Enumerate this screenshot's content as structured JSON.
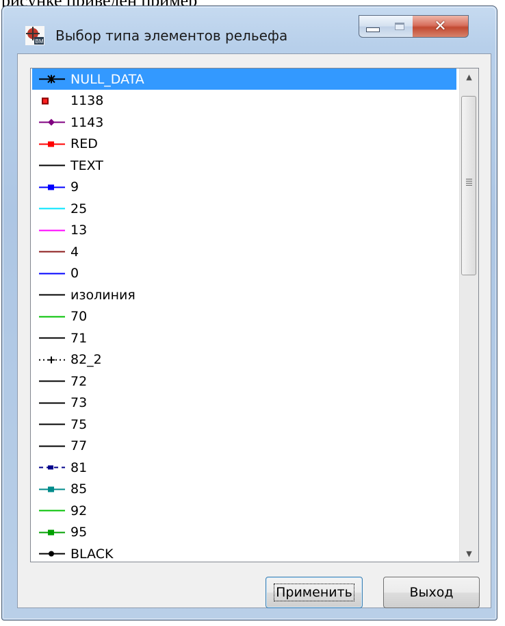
{
  "background_text": "рисунке приведен пример",
  "window": {
    "title": "Выбор типа элементов рельефа",
    "controls": {
      "minimize": "minimize-icon",
      "maximize": "maximize-icon",
      "close": "close-icon"
    }
  },
  "list": {
    "selected_index": 0,
    "items": [
      {
        "label": "NULL_DATA",
        "color": "#000000",
        "style": "star"
      },
      {
        "label": "1138",
        "color": "#8b0000",
        "style": "square-only"
      },
      {
        "label": "1143",
        "color": "#800080",
        "style": "diamond"
      },
      {
        "label": "RED",
        "color": "#ff0000",
        "style": "square"
      },
      {
        "label": "TEXT",
        "color": "#000000",
        "style": "line"
      },
      {
        "label": "9",
        "color": "#0000ff",
        "style": "square"
      },
      {
        "label": "25",
        "color": "#00e5ff",
        "style": "line"
      },
      {
        "label": "13",
        "color": "#ff00ff",
        "style": "line"
      },
      {
        "label": "4",
        "color": "#8b1a1a",
        "style": "line"
      },
      {
        "label": "0",
        "color": "#0000ff",
        "style": "line"
      },
      {
        "label": "изолиния",
        "color": "#000000",
        "style": "line"
      },
      {
        "label": "70",
        "color": "#00c000",
        "style": "line"
      },
      {
        "label": "71",
        "color": "#000000",
        "style": "line"
      },
      {
        "label": "82_2",
        "color": "#000000",
        "style": "dotted-plus"
      },
      {
        "label": "72",
        "color": "#000000",
        "style": "line"
      },
      {
        "label": "73",
        "color": "#000000",
        "style": "line"
      },
      {
        "label": "75",
        "color": "#000000",
        "style": "line"
      },
      {
        "label": "77",
        "color": "#000000",
        "style": "line"
      },
      {
        "label": "81",
        "color": "#00008b",
        "style": "dashed-square"
      },
      {
        "label": "85",
        "color": "#008b8b",
        "style": "square"
      },
      {
        "label": "92",
        "color": "#00c000",
        "style": "line"
      },
      {
        "label": "95",
        "color": "#00a000",
        "style": "square"
      },
      {
        "label": "BLACK",
        "color": "#000000",
        "style": "dot"
      }
    ]
  },
  "buttons": {
    "apply": "Применить",
    "exit": "Выход"
  },
  "colors": {
    "selection": "#3399ff",
    "title_bar": "#b9d1ea",
    "close_button": "#c75050"
  }
}
